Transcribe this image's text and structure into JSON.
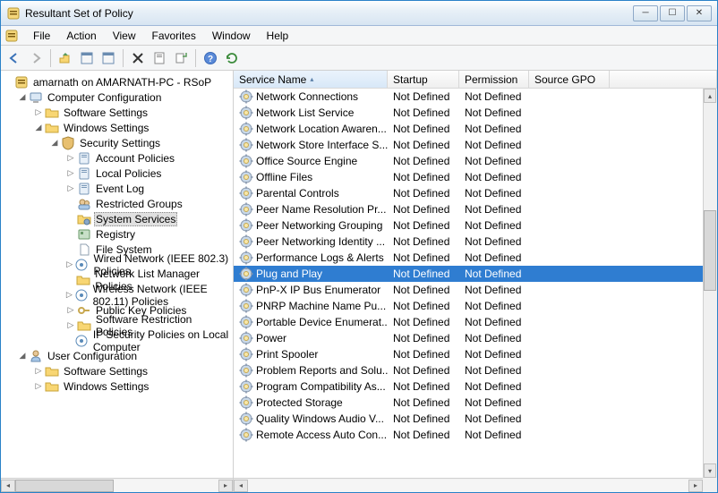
{
  "title": "Resultant Set of Policy",
  "menu": {
    "file": "File",
    "action": "Action",
    "view": "View",
    "favorites": "Favorites",
    "window": "Window",
    "help": "Help"
  },
  "tree": {
    "root": "amarnath on AMARNATH-PC - RSoP",
    "computer_config": "Computer Configuration",
    "software_settings": "Software Settings",
    "windows_settings": "Windows Settings",
    "security_settings": "Security Settings",
    "account_policies": "Account Policies",
    "local_policies": "Local Policies",
    "event_log": "Event Log",
    "restricted_groups": "Restricted Groups",
    "system_services": "System Services",
    "registry": "Registry",
    "file_system": "File System",
    "wired_network": "Wired Network (IEEE 802.3) Policies",
    "network_list": "Network List Manager Policies",
    "wireless_network": "Wireless Network (IEEE 802.11) Policies",
    "public_key": "Public Key Policies",
    "software_restriction": "Software Restriction Policies",
    "ip_security": "IP Security Policies on Local Computer",
    "user_config": "User Configuration",
    "user_software_settings": "Software Settings",
    "user_windows_settings": "Windows Settings"
  },
  "columns": {
    "name": "Service Name",
    "startup": "Startup",
    "permission": "Permission",
    "source_gpo": "Source GPO"
  },
  "selected_index": 11,
  "services": [
    {
      "name": "Network Connections",
      "startup": "Not Defined",
      "permission": "Not Defined",
      "gpo": ""
    },
    {
      "name": "Network List Service",
      "startup": "Not Defined",
      "permission": "Not Defined",
      "gpo": ""
    },
    {
      "name": "Network Location Awaren...",
      "startup": "Not Defined",
      "permission": "Not Defined",
      "gpo": ""
    },
    {
      "name": "Network Store Interface S...",
      "startup": "Not Defined",
      "permission": "Not Defined",
      "gpo": ""
    },
    {
      "name": "Office Source Engine",
      "startup": "Not Defined",
      "permission": "Not Defined",
      "gpo": ""
    },
    {
      "name": "Offline Files",
      "startup": "Not Defined",
      "permission": "Not Defined",
      "gpo": ""
    },
    {
      "name": "Parental Controls",
      "startup": "Not Defined",
      "permission": "Not Defined",
      "gpo": ""
    },
    {
      "name": "Peer Name Resolution Pr...",
      "startup": "Not Defined",
      "permission": "Not Defined",
      "gpo": ""
    },
    {
      "name": "Peer Networking Grouping",
      "startup": "Not Defined",
      "permission": "Not Defined",
      "gpo": ""
    },
    {
      "name": "Peer Networking Identity ...",
      "startup": "Not Defined",
      "permission": "Not Defined",
      "gpo": ""
    },
    {
      "name": "Performance Logs & Alerts",
      "startup": "Not Defined",
      "permission": "Not Defined",
      "gpo": ""
    },
    {
      "name": "Plug and Play",
      "startup": "Not Defined",
      "permission": "Not Defined",
      "gpo": ""
    },
    {
      "name": "PnP-X IP Bus Enumerator",
      "startup": "Not Defined",
      "permission": "Not Defined",
      "gpo": ""
    },
    {
      "name": "PNRP Machine Name Pu...",
      "startup": "Not Defined",
      "permission": "Not Defined",
      "gpo": ""
    },
    {
      "name": "Portable Device Enumerat...",
      "startup": "Not Defined",
      "permission": "Not Defined",
      "gpo": ""
    },
    {
      "name": "Power",
      "startup": "Not Defined",
      "permission": "Not Defined",
      "gpo": ""
    },
    {
      "name": "Print Spooler",
      "startup": "Not Defined",
      "permission": "Not Defined",
      "gpo": ""
    },
    {
      "name": "Problem Reports and Solu...",
      "startup": "Not Defined",
      "permission": "Not Defined",
      "gpo": ""
    },
    {
      "name": "Program Compatibility As...",
      "startup": "Not Defined",
      "permission": "Not Defined",
      "gpo": ""
    },
    {
      "name": "Protected Storage",
      "startup": "Not Defined",
      "permission": "Not Defined",
      "gpo": ""
    },
    {
      "name": "Quality Windows Audio V...",
      "startup": "Not Defined",
      "permission": "Not Defined",
      "gpo": ""
    },
    {
      "name": "Remote Access Auto Con...",
      "startup": "Not Defined",
      "permission": "Not Defined",
      "gpo": ""
    }
  ]
}
